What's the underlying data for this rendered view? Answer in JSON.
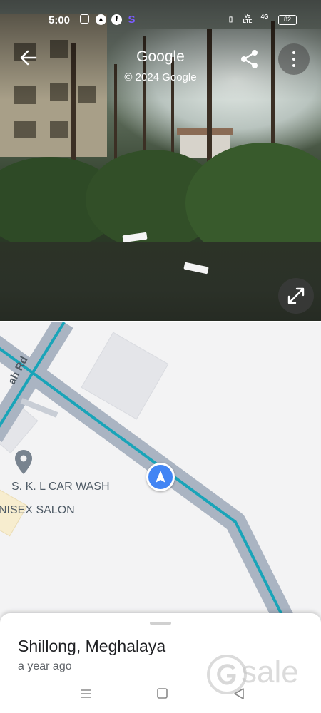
{
  "status_bar": {
    "time": "5:00",
    "battery": "82",
    "app_icons": [
      "instagram-icon",
      "a-app-icon",
      "facebook-icon",
      "s-app-icon"
    ],
    "system_icons": [
      "vibrate-icon",
      "volte-icon",
      "signal-4g-icon",
      "battery-icon"
    ],
    "volte_label": "Vo LTE",
    "network_label": "4G"
  },
  "street_view": {
    "title": "Google",
    "copyright": "© 2024 Google",
    "buttons": {
      "back": "back-arrow-icon",
      "share": "share-icon",
      "more": "more-vert-icon",
      "expand": "expand-icon"
    }
  },
  "map": {
    "road_label": "ah Rd",
    "places": [
      {
        "name": "S. K. L CAR WASH"
      },
      {
        "name": "NISEX SALON"
      }
    ],
    "route_color": "#19a4b8",
    "road_color": "#aab4c2",
    "location_arrow_color": "#4285f4"
  },
  "bottom_sheet": {
    "place_name": "Shillong, Meghalaya",
    "time_ago": "a year ago",
    "watermark": "sale"
  },
  "nav_bar": {
    "buttons": [
      "menu-icon",
      "home-square-icon",
      "back-triangle-icon"
    ]
  }
}
